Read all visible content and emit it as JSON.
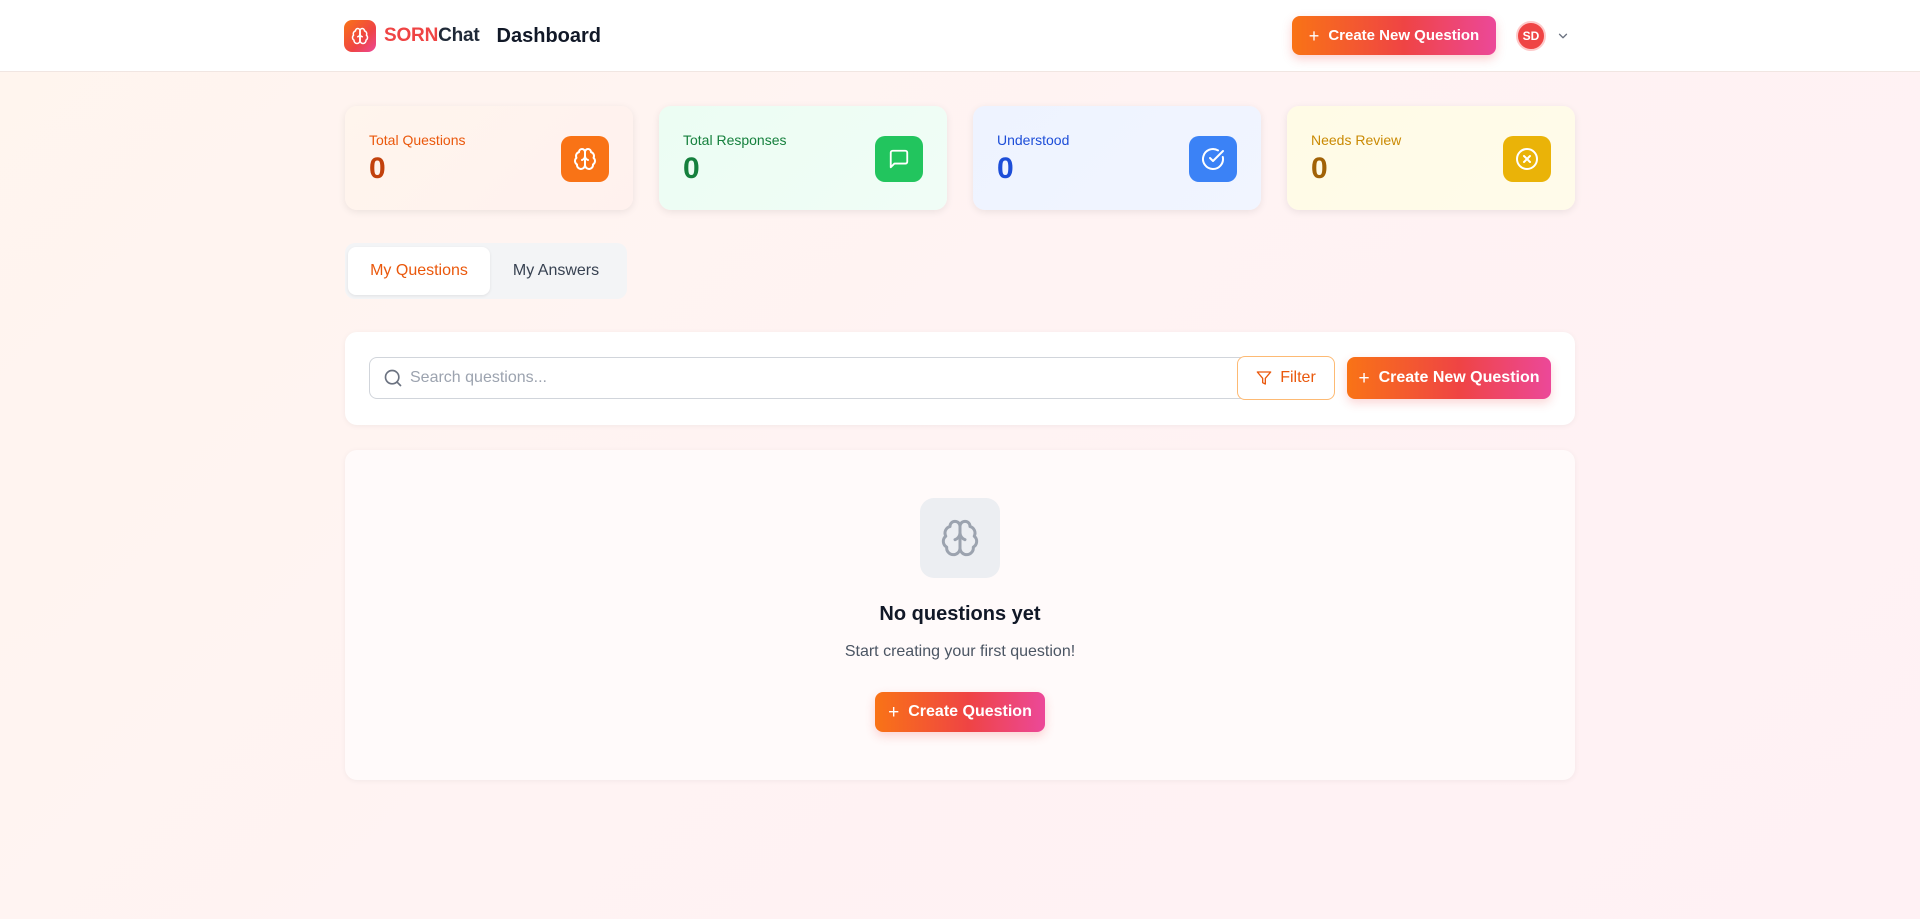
{
  "header": {
    "brand_primary": "SORN",
    "brand_secondary": "Chat",
    "page_title": "Dashboard",
    "cta_label": "Create New Question",
    "user_initials": "SD"
  },
  "stats": [
    {
      "label": "Total Questions",
      "value": "0",
      "icon": "brain-icon",
      "color": "#f97316"
    },
    {
      "label": "Total Responses",
      "value": "0",
      "icon": "message-square-icon",
      "color": "#22c55e"
    },
    {
      "label": "Understood",
      "value": "0",
      "icon": "check-circle-icon",
      "color": "#3b82f6"
    },
    {
      "label": "Needs Review",
      "value": "0",
      "icon": "x-circle-icon",
      "color": "#eab308"
    }
  ],
  "tabs": [
    {
      "label": "My Questions",
      "active": true
    },
    {
      "label": "My Answers",
      "active": false
    }
  ],
  "search": {
    "placeholder": "Search questions...",
    "value": "",
    "filter_label": "Filter",
    "cta_label": "Create New Question"
  },
  "empty_state": {
    "icon": "brain-icon",
    "title": "No questions yet",
    "subtitle": "Start creating your first question!",
    "cta_label": "Create Question"
  },
  "colors": {
    "accent_orange": "#f97316",
    "accent_red": "#ef4444",
    "accent_pink": "#ec4899"
  }
}
